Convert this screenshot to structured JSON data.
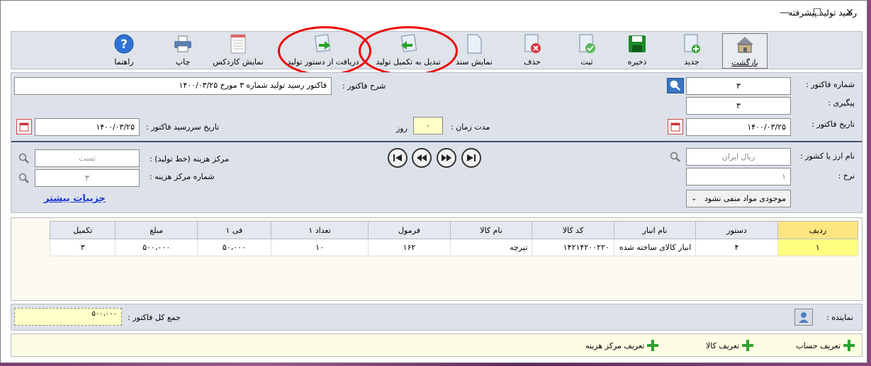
{
  "window": {
    "title": "رسید تولید  پیشرفته",
    "minimize": "—",
    "maximize": "☐",
    "close": "✕"
  },
  "toolbar": {
    "back": "بازگشت",
    "new": "جدید",
    "save": "ذخیره",
    "submit": "ثبت",
    "delete": "حذف",
    "show_doc": "نمایش سند",
    "convert": "تبدیل به تکمیل تولید",
    "receive": "دریافت از دستور تولید",
    "cardex": "نمایش کاردکس",
    "print": "چاپ",
    "help": "راهنما"
  },
  "form": {
    "invoice_no_label": "شماره فاکتور :",
    "invoice_no": "۳",
    "tracking_label": "پیگیری :",
    "tracking": "۳",
    "invoice_date_label": "تاریخ فاکتور :",
    "invoice_date": "۱۴۰۰/۰۳/۲۵",
    "desc_label": "شرح فاکتور :",
    "desc": "فاکتور رسید تولید شماره ۳ مورخ ۱۴۰۰/۰۳/۲۵",
    "duration_label": "مدت زمان :",
    "duration": "۰",
    "duration_unit": "روز",
    "due_date_label": "تاریخ سررسید فاکتور :",
    "due_date": "۱۴۰۰/۰۳/۲۵",
    "currency_label": "نام ارز یا کشور :",
    "currency": "ریال ایران",
    "rate_label": "نرخ :",
    "rate": "۱",
    "stock_select": "موجودی مواد منفی نشود",
    "cost_center_label": "مرکز هزینه (خط تولید) :",
    "cost_center": "تست",
    "cost_center_no_label": "شماره مرکز هزینه :",
    "cost_center_no": "۳",
    "more_details": "جزییات بیشتر"
  },
  "grid": {
    "headers": [
      "ردیف",
      "دستور",
      "نام انبار",
      "کد کالا",
      "نام کالا",
      "فرمول",
      "تعداد ۱",
      "فی ۱",
      "مبلغ",
      "تکمیل"
    ],
    "rows": [
      [
        "۱",
        "۴",
        "انبار کالای ساخته شده",
        "۱۴۲۱۴۲۰۰۲۲۰",
        "تیرچه",
        "۱۶۲",
        "۱۰",
        "۵۰،۰۰۰",
        "۵۰۰،۰۰۰",
        "۳"
      ]
    ]
  },
  "footer": {
    "rep_label": "نماینده :",
    "total_label": "جمع کل فاکتور :",
    "total": "۵۰۰،۰۰۰",
    "define_account": "تعریف حساب",
    "define_goods": "تعریف کالا",
    "define_cost_center": "تعریف مرکز هزینه"
  }
}
